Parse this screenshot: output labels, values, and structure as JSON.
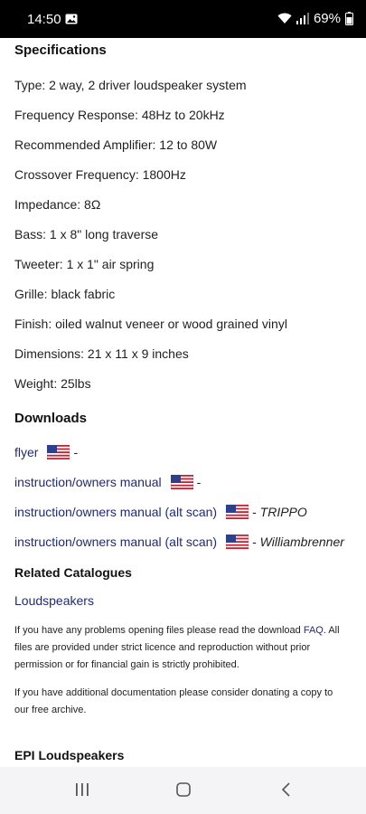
{
  "status_bar": {
    "time": "14:50",
    "battery": "69%"
  },
  "specifications": {
    "heading": "Specifications",
    "items": [
      "Type: 2 way, 2 driver loudspeaker system",
      "Frequency Response: 48Hz to 20kHz",
      "Recommended Amplifier: 12 to 80W",
      "Crossover Frequency: 1800Hz",
      "Impedance: 8Ω",
      "Bass: 1 x 8\" long traverse",
      "Tweeter: 1 x 1\" air spring",
      "Grille: black fabric",
      "Finish: oiled walnut veneer or wood grained vinyl",
      "Dimensions: 21 x 11 x 9 inches",
      "Weight: 25lbs"
    ]
  },
  "downloads": {
    "heading": "Downloads",
    "items": [
      {
        "label": "flyer",
        "suffix": "-",
        "contributor": ""
      },
      {
        "label": "instruction/owners manual",
        "suffix": "-",
        "contributor": ""
      },
      {
        "label": "instruction/owners manual (alt scan)",
        "suffix": "- ",
        "contributor": "TRIPPO"
      },
      {
        "label": "instruction/owners manual (alt scan)",
        "suffix": "- ",
        "contributor": "Williambrenner"
      }
    ]
  },
  "related": {
    "heading": "Related Catalogues",
    "link": "Loudspeakers"
  },
  "notice": {
    "before_faq": "If you have any problems opening files please read the download ",
    "faq": "FAQ",
    "after_faq": ". All files are provided under strict licence and reproduction without prior permission or for financial gain is strictly prohibited.",
    "donate": "If you have additional documentation please consider donating a copy to our free archive."
  },
  "next_section": {
    "heading": "EPI Loudspeakers"
  },
  "nav_icons": [
    "recents-icon",
    "home-icon",
    "back-icon"
  ]
}
